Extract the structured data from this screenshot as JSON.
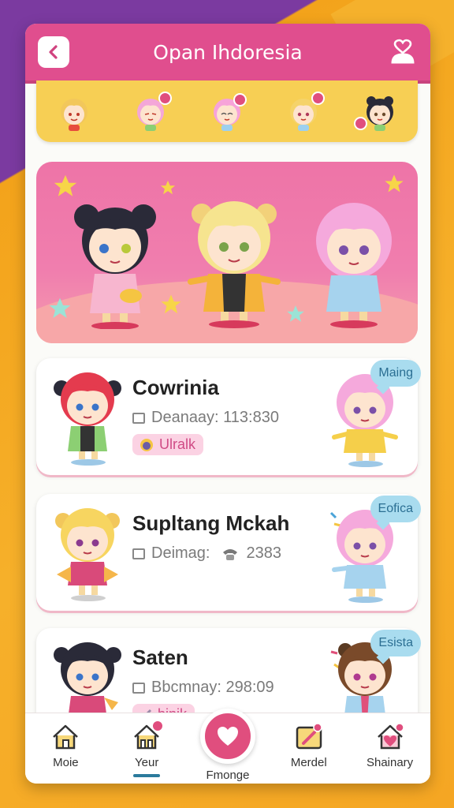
{
  "header": {
    "title": "Opan Ihdoresia",
    "back_icon": "chevron-left-icon",
    "user_icon": "user-heart-icon"
  },
  "colors": {
    "accent": "#e04e8e",
    "strip": "#f7cf54",
    "banner": "#ee74a7",
    "tag_bg": "#fbd2e3",
    "speech_bg": "#a9dcef"
  },
  "avatar_strip": {
    "items": [
      {
        "hair": "#f2c75b",
        "badge": false
      },
      {
        "hair": "#f4a7d8",
        "badge": true
      },
      {
        "hair": "#f7a3d9",
        "badge": true
      },
      {
        "hair": "#f5d36a",
        "badge": true
      },
      {
        "hair": "#2a2a38",
        "badge": true
      }
    ]
  },
  "characters": [
    {
      "name": "Cowrinia",
      "meta": "Deanaay: 113:830",
      "tag": "Ulralk",
      "bubble": "Maing"
    },
    {
      "name": "Supltang Mckah",
      "meta": "Deimag:",
      "meta_extra": "2383",
      "bubble": "Eofica"
    },
    {
      "name": "Saten",
      "meta": "Bbcmnay: 298:09",
      "tag": "binik",
      "bubble": "Esista"
    }
  ],
  "nav": {
    "items": [
      {
        "label": "Moie",
        "icon": "home-icon"
      },
      {
        "label": "Yeur",
        "icon": "house-badge-icon"
      },
      {
        "label": "Fmonge",
        "icon": "heart-icon"
      },
      {
        "label": "Merdel",
        "icon": "edit-icon"
      },
      {
        "label": "Shainary",
        "icon": "shop-icon"
      }
    ]
  }
}
